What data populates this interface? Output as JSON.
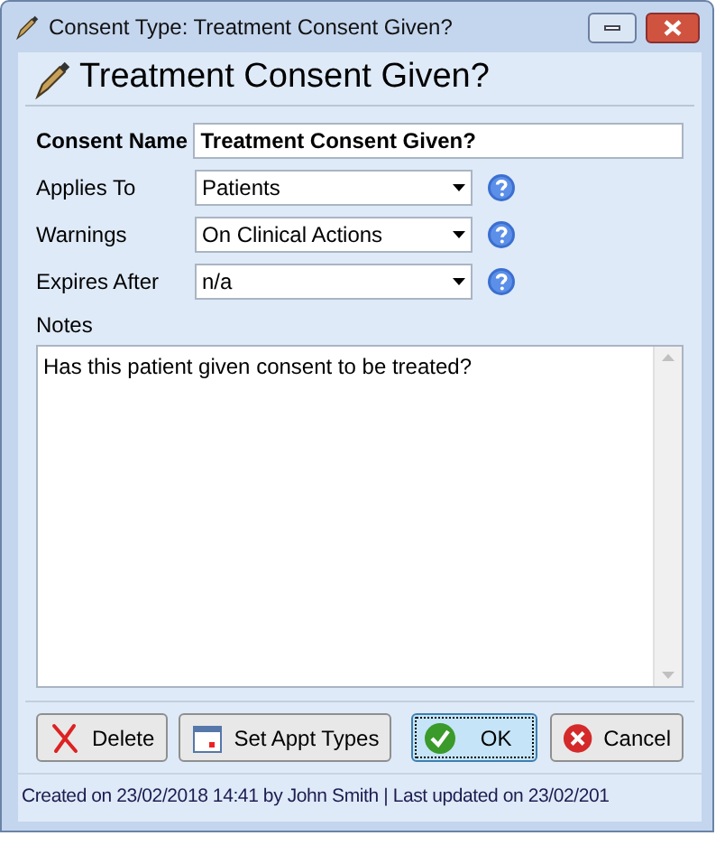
{
  "window": {
    "title": "Consent Type: Treatment Consent Given?"
  },
  "header": {
    "title": "Treatment Consent Given?"
  },
  "form": {
    "consent_name": {
      "label": "Consent Name",
      "value": "Treatment Consent Given?"
    },
    "dropdowns": [
      {
        "label": "Applies To",
        "value": "Patients"
      },
      {
        "label": "Warnings",
        "value": "On Clinical Actions"
      },
      {
        "label": "Expires After",
        "value": "n/a"
      }
    ],
    "notes": {
      "label": "Notes",
      "value": "Has this patient given consent to be treated?"
    }
  },
  "buttons": [
    {
      "kind": "delete",
      "label": "Delete",
      "selected": false
    },
    {
      "kind": "calendar",
      "label": "Set Appt Types",
      "selected": false
    },
    {
      "kind": "ok",
      "label": "OK",
      "selected": true
    },
    {
      "kind": "cancel",
      "label": "Cancel",
      "selected": false
    }
  ],
  "status_bar": "Created on 23/02/2018 14:41 by John Smith | Last updated on 23/02/201"
}
